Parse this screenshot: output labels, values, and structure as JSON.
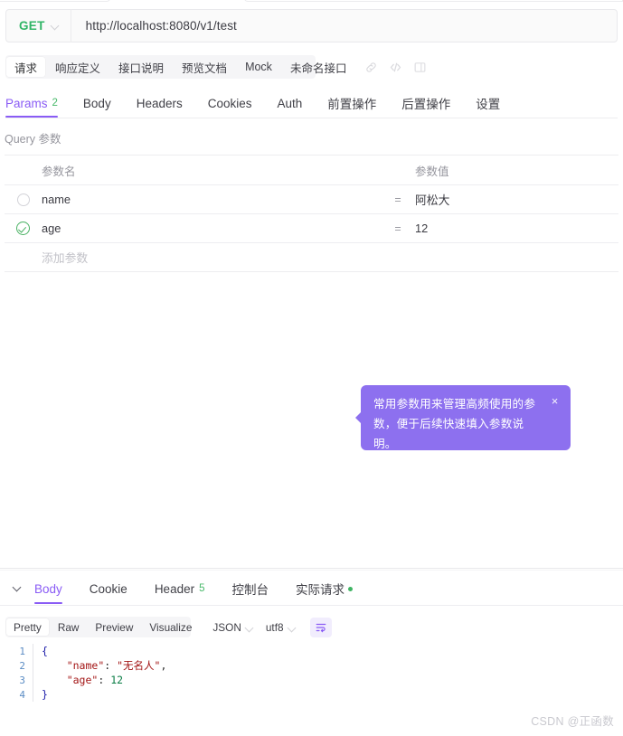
{
  "request_bar": {
    "method": "GET",
    "method_dropdown_icon": "chevron-down-icon",
    "url": "http://localhost:8080/v1/test"
  },
  "doc_tabs": {
    "items": [
      {
        "label": "请求",
        "selected": true
      },
      {
        "label": "响应定义",
        "selected": false
      },
      {
        "label": "接口说明",
        "selected": false
      },
      {
        "label": "预览文档",
        "selected": false
      },
      {
        "label": "Mock",
        "selected": false
      },
      {
        "label": "未命名接口",
        "selected": false
      }
    ],
    "icons": [
      {
        "name": "link-icon"
      },
      {
        "name": "code-icon"
      },
      {
        "name": "panel-layout-icon"
      }
    ]
  },
  "main_tabs": {
    "items": [
      {
        "label": "Params",
        "badge": "2",
        "selected": true
      },
      {
        "label": "Body",
        "badge": "",
        "selected": false
      },
      {
        "label": "Headers",
        "badge": "",
        "selected": false
      },
      {
        "label": "Cookies",
        "badge": "",
        "selected": false
      },
      {
        "label": "Auth",
        "badge": "",
        "selected": false
      },
      {
        "label": "前置操作",
        "badge": "",
        "selected": false
      },
      {
        "label": "后置操作",
        "badge": "",
        "selected": false
      },
      {
        "label": "设置",
        "badge": "",
        "selected": false
      }
    ]
  },
  "params_section": {
    "title": "Query 参数",
    "columns": {
      "name": "参数名",
      "value": "参数值"
    },
    "equals_sign": "=",
    "rows": [
      {
        "checked": false,
        "name": "name",
        "value": "阿松大"
      },
      {
        "checked": true,
        "name": "age",
        "value": "12"
      }
    ],
    "add_row_placeholder": "添加参数"
  },
  "tooltip": {
    "text": "常用参数用来管理高频使用的参数，便于后续快速填入参数说明。",
    "close_icon": "close-icon",
    "background_color": "#8d70ef"
  },
  "response": {
    "collapse_icon": "chevron-down-icon",
    "tabs": [
      {
        "label": "Body",
        "badge": "",
        "selected": true,
        "dot": false
      },
      {
        "label": "Cookie",
        "badge": "",
        "selected": false,
        "dot": false
      },
      {
        "label": "Header",
        "badge": "5",
        "selected": false,
        "dot": false
      },
      {
        "label": "控制台",
        "badge": "",
        "selected": false,
        "dot": false
      },
      {
        "label": "实际请求",
        "badge": "",
        "selected": false,
        "dot": true
      }
    ],
    "viewer_toolbar": {
      "modes": [
        {
          "label": "Pretty",
          "selected": true
        },
        {
          "label": "Raw",
          "selected": false
        },
        {
          "label": "Preview",
          "selected": false
        },
        {
          "label": "Visualize",
          "selected": false
        }
      ],
      "format_select": "JSON",
      "encoding_select": "utf8",
      "wrap_icon": "text-wrap-icon"
    },
    "body_lines": [
      {
        "num": "1",
        "segments": [
          {
            "text": "{",
            "cls": "k-brace"
          }
        ]
      },
      {
        "num": "2",
        "segments": [
          {
            "text": "    ",
            "cls": "k-punct"
          },
          {
            "text": "\"name\"",
            "cls": "k-key"
          },
          {
            "text": ": ",
            "cls": "k-punct"
          },
          {
            "text": "\"无名人\"",
            "cls": "k-str"
          },
          {
            "text": ",",
            "cls": "k-punct"
          }
        ]
      },
      {
        "num": "3",
        "segments": [
          {
            "text": "    ",
            "cls": "k-punct"
          },
          {
            "text": "\"age\"",
            "cls": "k-key"
          },
          {
            "text": ": ",
            "cls": "k-punct"
          },
          {
            "text": "12",
            "cls": "k-num"
          }
        ]
      },
      {
        "num": "4",
        "segments": [
          {
            "text": "}",
            "cls": "k-brace"
          }
        ]
      }
    ]
  },
  "watermark": "CSDN @正函数",
  "colors": {
    "accent_purple": "#8a5cf5",
    "method_green": "#30b566",
    "badge_green": "#48b96a"
  }
}
